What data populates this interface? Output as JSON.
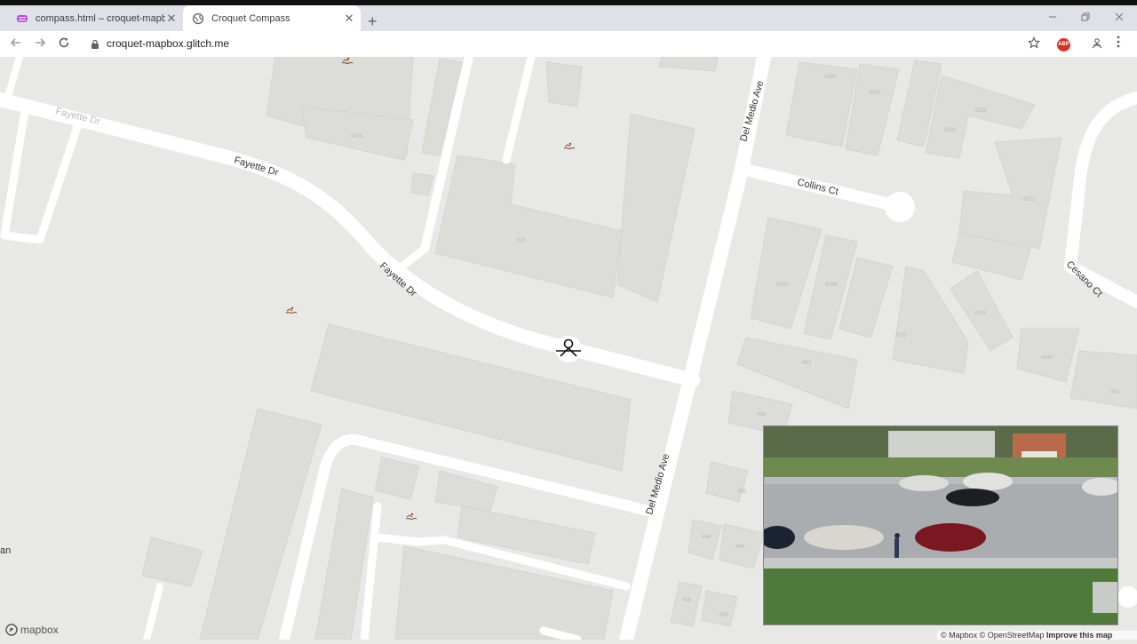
{
  "browser": {
    "tabs": [
      {
        "title": "compass.html – croquet-mapbox",
        "active": false,
        "favicon": "glitch-icon"
      },
      {
        "title": "Croquet Compass",
        "active": true,
        "favicon": "globe-icon"
      }
    ],
    "close_glyph": "✕",
    "new_tab_glyph": "+",
    "url": "croquet-mapbox.glitch.me",
    "extension_badge": "ABP"
  },
  "map": {
    "street_labels": [
      "Fayette Dr",
      "Fayette Dr",
      "Fayette Dr",
      "Del Medio Ave",
      "Del Medio Ave",
      "Collins Ct",
      "Cesano Ct",
      "an"
    ],
    "building_numbers": [
      "4280",
      "4209",
      "4233",
      "4221",
      "521",
      "4210",
      "4206",
      "4216",
      "4212",
      "4240",
      "441",
      "4229",
      "456",
      "450",
      "448",
      "444",
      "438",
      "430",
      "3679",
      "442"
    ],
    "poi_icon": "swimming-icon",
    "user_marker_icon": "avatar-compass-icon"
  },
  "attribution": {
    "logo_text": "mapbox",
    "text": "© Mapbox © OpenStreetMap",
    "improve_link": "Improve this map"
  },
  "colors": {
    "map_bg": "#e8e8e6",
    "road": "#ffffff",
    "building": "#dcdcd8",
    "building_stroke": "#d3d3cf",
    "label": "#333333"
  }
}
